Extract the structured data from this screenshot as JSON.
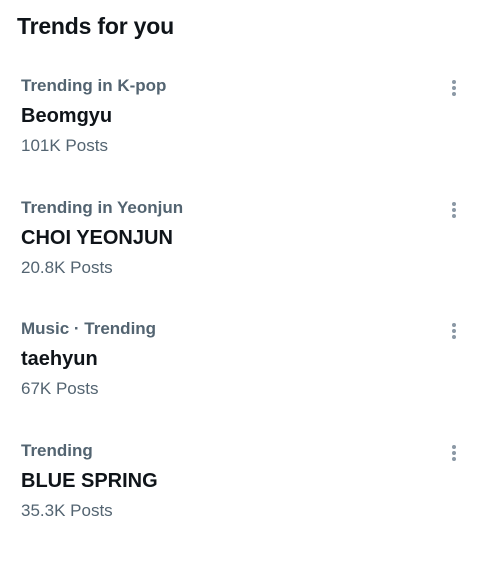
{
  "panel": {
    "title": "Trends for you"
  },
  "trends": [
    {
      "context": "Trending in K-pop",
      "name": "Beomgyu",
      "count": "101K Posts"
    },
    {
      "context": "Trending in Yeonjun",
      "name": "CHOI YEONJUN",
      "count": "20.8K Posts"
    },
    {
      "context": "Music · Trending",
      "name": "taehyun",
      "count": "67K Posts"
    },
    {
      "context": "Trending",
      "name": "BLUE SPRING",
      "count": "35.3K Posts"
    }
  ],
  "icons": {
    "more": "more-vertical-icon"
  },
  "colors": {
    "primary_text": "#0f1419",
    "secondary_text": "#536471",
    "icon": "#8b98a5"
  }
}
